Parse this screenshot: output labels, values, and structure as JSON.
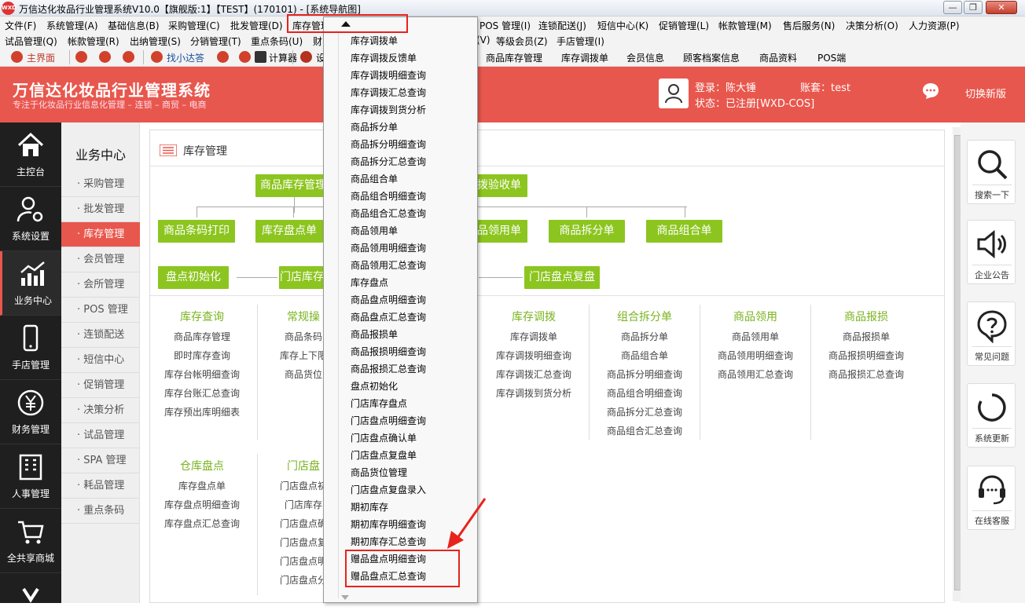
{
  "window": {
    "logo_text": "WXD",
    "title": "万信达化妆品行业管理系统V10.0【旗舰版:1】【TEST】(170101) - [系统导航图]",
    "min_label": "—",
    "max_label": "❐",
    "close_label": "✕"
  },
  "menubar1": [
    "文件(F)",
    "系统管理(A)",
    "基础信息(B)",
    "采购管理(C)",
    "批发管理(D)",
    "库存管理",
    "POS 管理(I)",
    "连锁配送(J)",
    "短信中心(K)",
    "促销管理(L)",
    "帐款管理(M)",
    "售后服务(N)",
    "决策分析(O)",
    "人力资源(P)"
  ],
  "menubar2": [
    "试品管理(Q)",
    "帐款管理(R)",
    "出纳管理(S)",
    "分销管理(T)",
    "重点条码(U)",
    "财",
    "(V)",
    "等级会员(Z)",
    "手店管理(I)"
  ],
  "toolbar": {
    "home": "主界面",
    "help": "找小达答",
    "calc": "计算器",
    "settings": "设",
    "links": [
      "商品库存管理",
      "库存调拨单",
      "会员信息",
      "顾客档案信息",
      "商品资料",
      "POS端"
    ]
  },
  "header": {
    "title": "万信达化妆品行业管理系统",
    "subtitle": "专注于化妆品行业信息化管理 – 连锁 – 商贸 – 电商",
    "login": "登录：陈大锤",
    "account": "账套：test",
    "status": "状态：已注册[WXD-COS]",
    "switch": "切换新版"
  },
  "leftnav": [
    "主控台",
    "系统设置",
    "业务中心",
    "手店管理",
    "财务管理",
    "人事管理",
    "全共享商城"
  ],
  "subnav": {
    "title": "业务中心",
    "items": [
      "采购管理",
      "批发管理",
      "库存管理",
      "会员管理",
      "会所管理",
      "POS 管理",
      "连锁配送",
      "短信中心",
      "促销管理",
      "决策分析",
      "试品管理",
      "SPA 管理",
      "耗品管理",
      "重点条码"
    ]
  },
  "main": {
    "title": "库存管理",
    "flow": {
      "stock_manage": "商品库存管理",
      "inspect": "拨验收单",
      "barcode": "商品条码打印",
      "stocktake": "库存盘点单",
      "use": "品领用单",
      "split": "商品拆分单",
      "combine": "商品组合单",
      "init": "盘点初始化",
      "store_stock": "门店库存",
      "store_recheck": "门店盘点复盘"
    },
    "groups": [
      {
        "title": "库存查询",
        "items": [
          "商品库存管理",
          "即时库存查询",
          "库存台帐明细查询",
          "库存台账汇总查询",
          "库存预出库明细表"
        ]
      },
      {
        "title": "常规操",
        "items": [
          "商品条码",
          "库存上下限",
          "商品货位"
        ]
      },
      {
        "title": "库存调拨",
        "items": [
          "库存调拨单",
          "库存调拨明细查询",
          "库存调拨汇总查询",
          "库存调拨到货分析"
        ]
      },
      {
        "title": "组合拆分单",
        "items": [
          "商品拆分单",
          "商品组合单",
          "商品拆分明细查询",
          "商品组合明细查询",
          "商品拆分汇总查询",
          "商品组合汇总查询"
        ]
      },
      {
        "title": "商品领用",
        "items": [
          "商品领用单",
          "商品领用明细查询",
          "商品领用汇总查询"
        ]
      },
      {
        "title": "商品报损",
        "items": [
          "商品报损单",
          "商品报损明细查询",
          "商品报损汇总查询"
        ]
      },
      {
        "title": "仓库盘点",
        "items": [
          "库存盘点单",
          "库存盘点明细查询",
          "库存盘点汇总查询"
        ]
      },
      {
        "title": "门店盘",
        "items": [
          "门店盘点初",
          "门店库存",
          "门店盘点确",
          "门店盘点复",
          "门店盘点明",
          "门店盘点分"
        ]
      }
    ]
  },
  "rightbar": [
    "搜索一下",
    "企业公告",
    "常见问题",
    "系统更新",
    "在线客服"
  ],
  "dropdown": {
    "items": [
      "库存调拨单",
      "库存调拨反馈单",
      "库存调拨明细查询",
      "库存调拨汇总查询",
      "库存调拨到货分析",
      "商品拆分单",
      "商品拆分明细查询",
      "商品拆分汇总查询",
      "商品组合单",
      "商品组合明细查询",
      "商品组合汇总查询",
      "商品领用单",
      "商品领用明细查询",
      "商品领用汇总查询",
      "库存盘点",
      "商品盘点明细查询",
      "商品盘点汇总查询",
      "商品报损单",
      "商品报损明细查询",
      "商品报损汇总查询",
      "盘点初始化",
      "门店库存盘点",
      "门店盘点明细查询",
      "门店盘点确认单",
      "门店盘点复盘单",
      "商品货位管理",
      "门店盘点复盘录入",
      "期初库存",
      "期初库存明细查询",
      "期初库存汇总查询",
      "赠品盘点明细查询",
      "赠品盘点汇总查询"
    ]
  },
  "colors": {
    "accent": "#e8574d",
    "green": "#8cc51f",
    "highlight": "#e8231c"
  }
}
